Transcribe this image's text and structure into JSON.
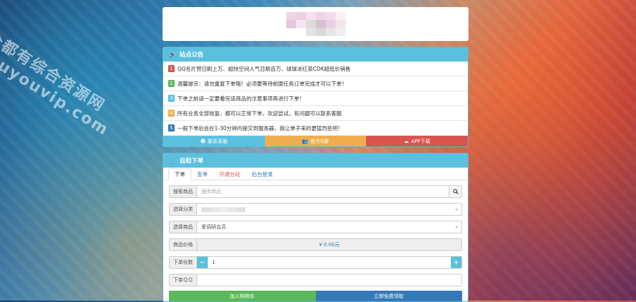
{
  "watermark": {
    "line1": "全都有综合资源网",
    "line2": "douyouvip.com"
  },
  "notice": {
    "title": "站点公告",
    "items": [
      {
        "n": "1",
        "text": "QQ名片赞日刷上万、超快空间人气日刷百万、球球冰红茶CDK超低价销售",
        "color": "#d9534f"
      },
      {
        "n": "2",
        "text": "温馨提示：请勿重复下单哦！必须要等待前面任务订单完成才可以下单！",
        "color": "#5cb85c"
      },
      {
        "n": "3",
        "text": "下单之前请一定要看完该商品的注意事项再进行下单！",
        "color": "#5bc0de"
      },
      {
        "n": "4",
        "text": "所有业务全部恢复，都可以正常下单，欢迎尝试，有问题可以联系客服",
        "color": "#f0ad4e"
      },
      {
        "n": "5",
        "text": "一般下单后会在1-30分钟内提交到服务器，我让单子来的更猛烈些吧！",
        "color": "#337ab7"
      }
    ],
    "buttons": [
      {
        "label": "联系客服",
        "icon": "qq-icon",
        "color": "#5bc0de"
      },
      {
        "label": "官方Q群",
        "icon": "group-icon",
        "color": "#f0ad4e"
      },
      {
        "label": "APP下载",
        "icon": "cloud-download-icon",
        "color": "#d9534f"
      }
    ]
  },
  "order": {
    "title": "自助下单",
    "tabs": [
      {
        "label": "下单",
        "active": true
      },
      {
        "label": "查单"
      },
      {
        "label": "开通分站",
        "color": "#d9534f"
      },
      {
        "label": "后台登录"
      }
    ],
    "search_label": "搜索商品",
    "search_placeholder": "搜索商品",
    "category_label": "选择分类",
    "product_label": "选择商品",
    "product_value": "爱调研会员",
    "price_label": "商品价格",
    "price_value": "¥ 0.00元",
    "qty_label": "下单份数",
    "qty_value": "1",
    "qq_label": "下单ＱＱ",
    "add_cart": "加入购物车",
    "claim": "立即免费领取"
  }
}
